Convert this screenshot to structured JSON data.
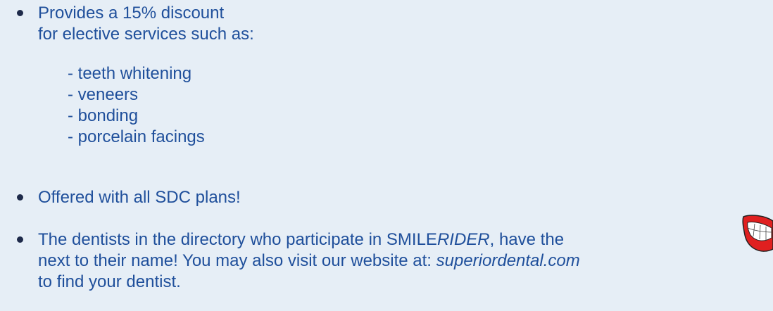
{
  "bullet1": {
    "line1": "Provides a 15% discount",
    "line2": "for elective services such as:",
    "items": [
      "- teeth whitening",
      "- veneers",
      "- bonding",
      "- porcelain facings"
    ]
  },
  "bullet2": {
    "text": "Offered with all SDC plans!"
  },
  "bullet3": {
    "line1_pre": "The dentists in the directory who participate in SMILE",
    "line1_em": "RIDER",
    "line1_post": ", have the",
    "line2_pre": "next to their name!  You may also visit our website at: ",
    "line2_em": "superiordental.com",
    "line3": "to find your dentist."
  },
  "icons": {
    "smile": "smile-icon"
  },
  "colors": {
    "background": "#e6eef6",
    "text": "#1f4f9b",
    "bullet": "#1e2a4a",
    "lips": "#e02020"
  }
}
